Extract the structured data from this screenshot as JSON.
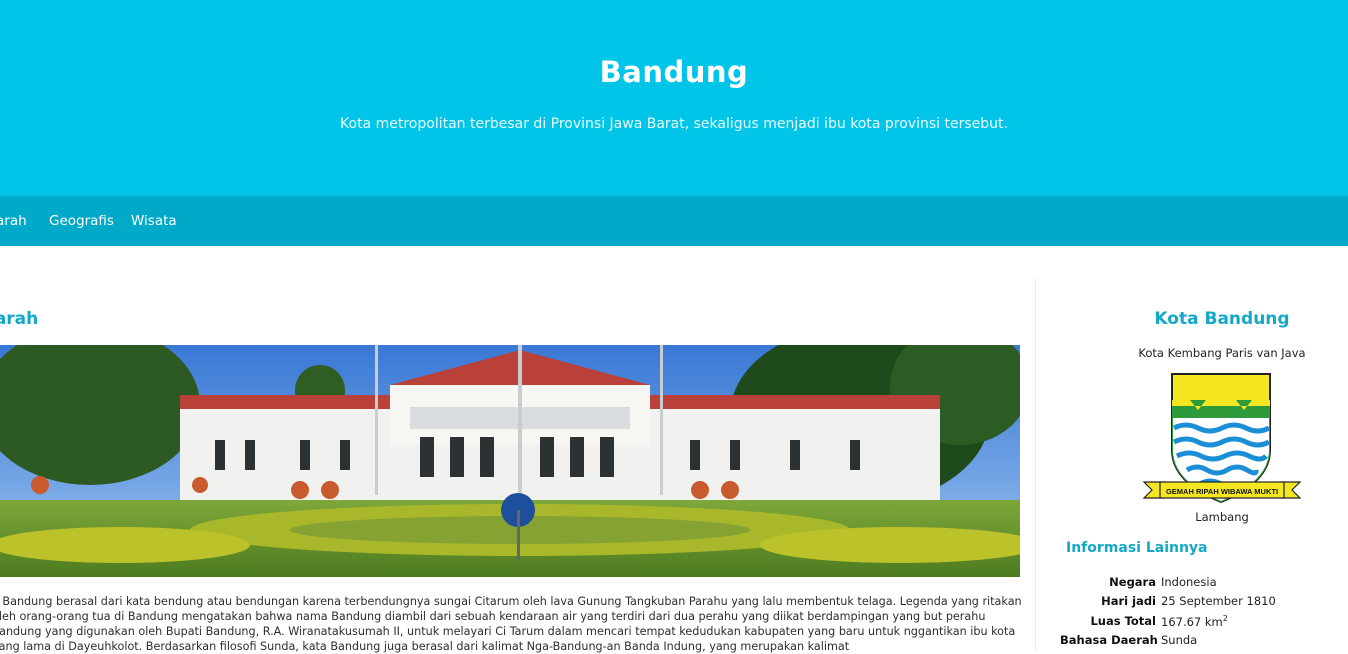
{
  "header": {
    "title": "Bandung",
    "subtitle": "Kota metropolitan terbesar di Provinsi Jawa Barat, sekaligus menjadi ibu kota provinsi tersebut."
  },
  "nav": {
    "items": [
      {
        "label": "arah"
      },
      {
        "label": "Geografis"
      },
      {
        "label": "Wisata"
      }
    ]
  },
  "main": {
    "section_title": "jarah",
    "article_text": "a Bandung berasal dari kata bendung atau bendungan karena terbendungnya sungai Citarum oleh lava Gunung Tangkuban Parahu yang lalu membentuk telaga. Legenda yang ritakan oleh orang-orang tua di Bandung mengatakan bahwa nama Bandung diambil dari sebuah kendaraan air yang terdiri dari dua perahu yang diikat berdampingan yang but perahu bandung yang digunakan oleh Bupati Bandung, R.A. Wiranatakusumah II, untuk melayari Ci Tarum dalam mencari tempat kedudukan kabupaten yang baru untuk nggantikan ibu kota yang lama di Dayeuhkolot. Berdasarkan filosofi Sunda, kata Bandung juga berasal dari kalimat Nga-Bandung-an Banda Indung, yang merupakan kalimat"
  },
  "sidebar": {
    "title": "Kota Bandung",
    "motto": "Kota Kembang Paris van Java",
    "emblem_caption": "Lambang",
    "emblem_ribbon_text": "GEMAH RIPAH WIBAWA MUKTI",
    "info_heading": "Informasi Lainnya",
    "info": [
      {
        "key": "Negara",
        "value": "Indonesia"
      },
      {
        "key": "Hari jadi",
        "value": "25 September 1810"
      },
      {
        "key": "Luas Total",
        "value": "167.67 km",
        "sup": "2"
      },
      {
        "key": "Bahasa Daerah",
        "value": "Sunda"
      }
    ]
  },
  "colors": {
    "hero_bg": "#00c5e8",
    "nav_bg": "#00a9c8",
    "accent": "#14a8c8"
  }
}
